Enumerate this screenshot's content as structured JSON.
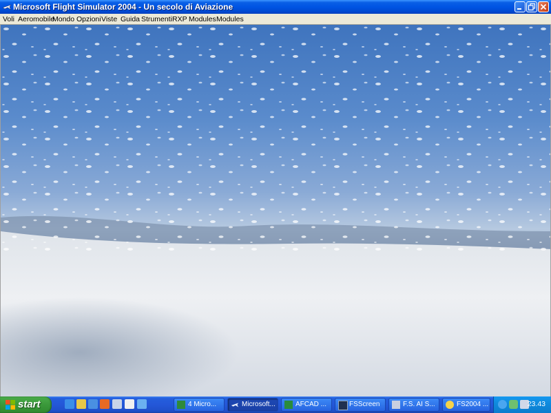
{
  "window": {
    "title": "Microsoft Flight Simulator 2004 - Un secolo di Aviazione",
    "app_icon": "airplane-icon",
    "controls": [
      "minimize-icon",
      "maximize-icon",
      "close-icon"
    ]
  },
  "menu": [
    "Voli",
    "Aeromobile",
    "Mondo",
    "Opzioni",
    "Viste",
    "Guida",
    "Strumenti",
    "RXP",
    "Modules",
    "Modules"
  ],
  "scene": {
    "description_icon": "flight-view",
    "sky_colors": [
      "#3f74be",
      "#6f99cf",
      "#b6c9e0"
    ],
    "ground_colors": [
      "#dfe4ea",
      "#9aa8ba"
    ]
  },
  "taskbar": {
    "start_label": "start",
    "quick_launch": [
      "ie-icon",
      "media-icon",
      "ie2-icon",
      "firefox-icon",
      "folder-icon",
      "mail-icon",
      "player-icon"
    ],
    "tasks": [
      {
        "label": "4 Micro...",
        "icon": "excel-icon",
        "active": false
      },
      {
        "label": "Microsoft...",
        "icon": "airplane-icon",
        "active": true
      },
      {
        "label": "AFCAD ...",
        "icon": "afcad-icon",
        "active": false
      },
      {
        "label": "FSScreen",
        "icon": "fsscreen-icon",
        "active": false
      },
      {
        "label": "F.S. AI S...",
        "icon": "plane-ai-icon",
        "active": false
      },
      {
        "label": "FS2004 ...",
        "icon": "globe-icon",
        "active": false
      }
    ],
    "tray_icons": [
      "network-icon",
      "users-icon",
      "volume-icon"
    ],
    "clock": "23.43"
  }
}
